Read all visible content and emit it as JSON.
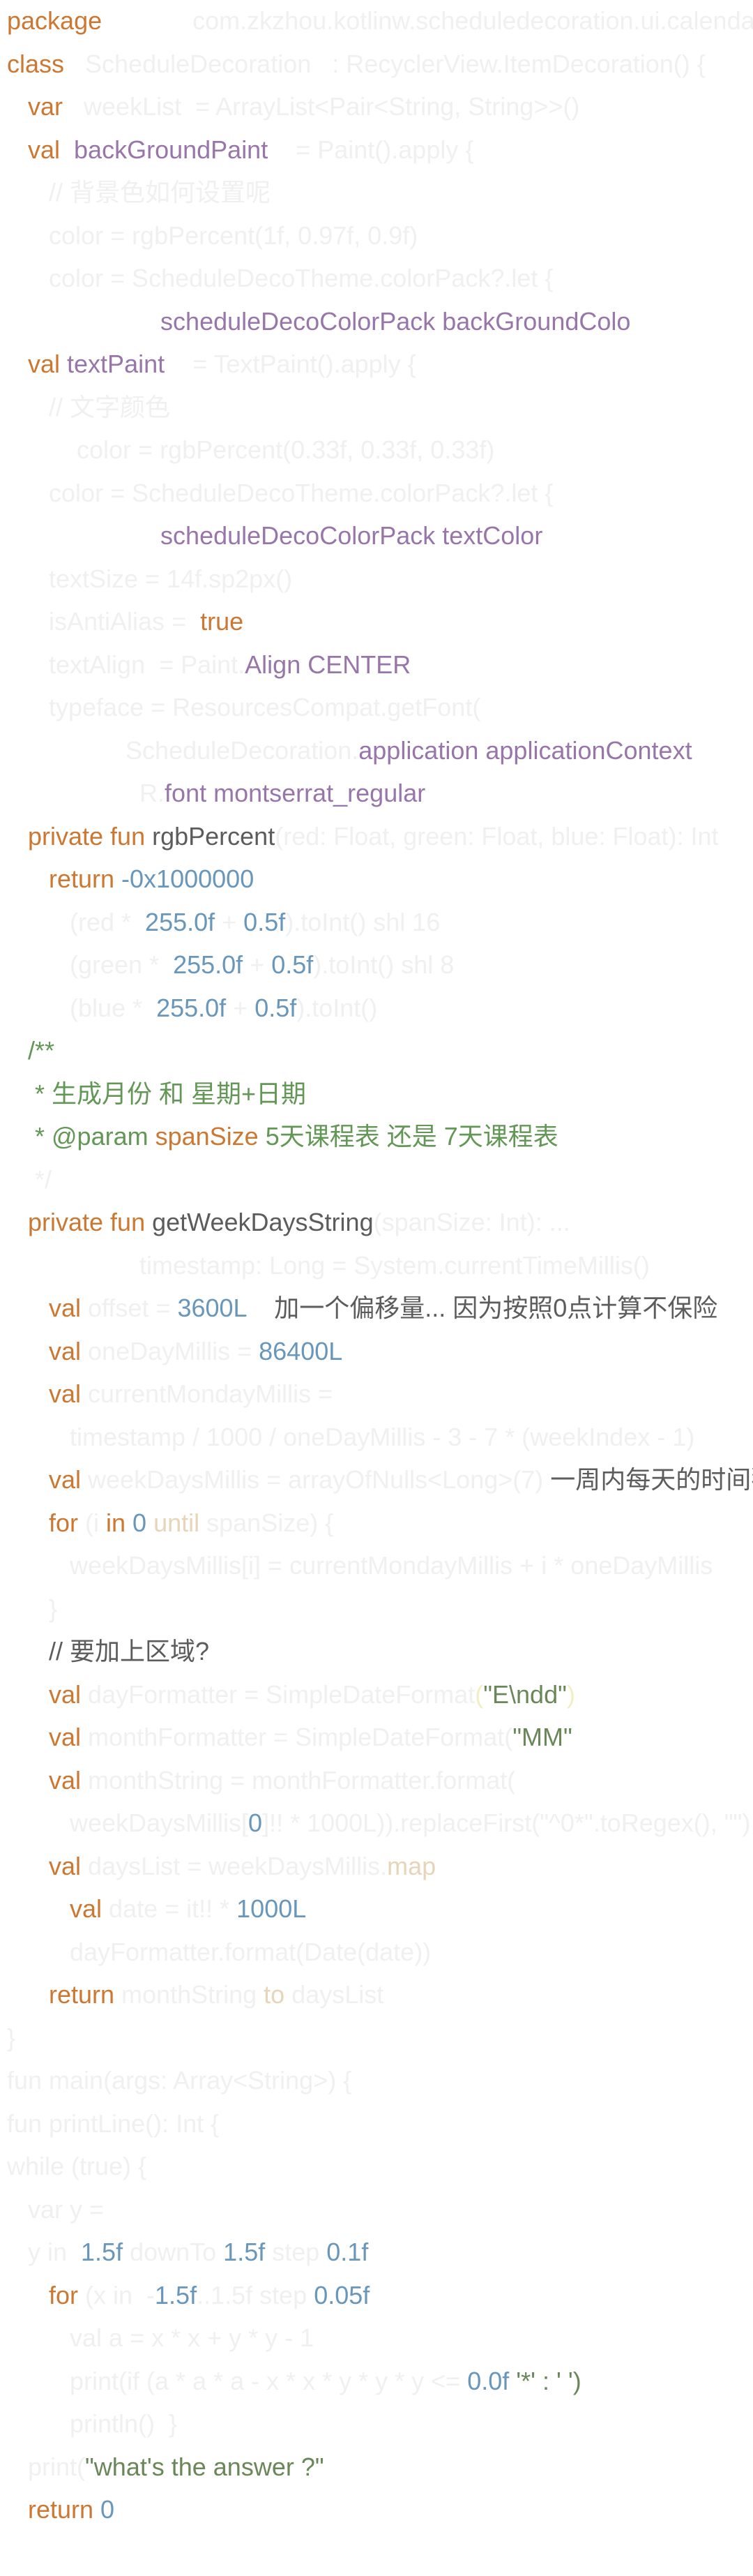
{
  "colors": {
    "keyword": "#cc7832",
    "number": "#6897bb",
    "purple": "#9876aa",
    "comment": "#629755",
    "string": "#6a8759",
    "text": "#5c5c5c",
    "faint": "#f0f0f0",
    "faint_gold": "#e6d5b8",
    "faint_yellow": "#f2eec4"
  },
  "lines": [
    {
      "indent": 0,
      "tokens": [
        {
          "t": "package",
          "c": "keyword"
        },
        {
          "t": "             com.zkzhou.kotlinw.scheduledecoration.ui.calendar",
          "c": "faint"
        }
      ]
    },
    {
      "indent": 0,
      "tokens": [
        {
          "t": "class",
          "c": "keyword"
        },
        {
          "t": "   ScheduleDecoration   : RecyclerView.ItemDecoration() {",
          "c": "faint"
        }
      ]
    },
    {
      "indent": 1,
      "tokens": [
        {
          "t": "var",
          "c": "keyword"
        },
        {
          "t": "   weekList  = ArrayList<Pair<String, String>>()",
          "c": "faint"
        }
      ]
    },
    {
      "indent": 1,
      "tokens": [
        {
          "t": "val",
          "c": "keyword"
        },
        {
          "t": "  backGroundPaint",
          "c": "purple"
        },
        {
          "t": "    = Paint().apply {",
          "c": "faint"
        }
      ]
    },
    {
      "indent": 2,
      "tokens": [
        {
          "t": "// 背景色如何设置呢",
          "c": "faint"
        }
      ]
    },
    {
      "indent": 2,
      "tokens": [
        {
          "t": "color = rgbPercent(1f, 0.97f, 0.9f)",
          "c": "faint"
        }
      ]
    },
    {
      "indent": 2,
      "tokens": [
        {
          "t": "color = ScheduleDecoTheme.colorPack?.let {",
          "c": "faint"
        }
      ]
    },
    {
      "indent": 0,
      "tokens": [
        {
          "t": "                      ",
          "c": "faint"
        },
        {
          "t": "scheduleDecoColorPack backGroundColo",
          "c": "purple"
        }
      ]
    },
    {
      "indent": 1,
      "tokens": [
        {
          "t": "val",
          "c": "keyword"
        },
        {
          "t": " textPaint",
          "c": "purple"
        },
        {
          "t": "    = TextPaint().apply {",
          "c": "faint"
        }
      ]
    },
    {
      "indent": 2,
      "tokens": [
        {
          "t": "// 文字颜色",
          "c": "faint"
        }
      ]
    },
    {
      "indent": 2,
      "tokens": [
        {
          "t": "    color = rgbPercent(0.33f, 0.33f, 0.33f)",
          "c": "faint"
        }
      ]
    },
    {
      "indent": 2,
      "tokens": [
        {
          "t": "color = ScheduleDecoTheme.colorPack?.let {",
          "c": "faint"
        }
      ]
    },
    {
      "indent": 0,
      "tokens": [
        {
          "t": "                      ",
          "c": "faint"
        },
        {
          "t": "scheduleDecoColorPack textColor",
          "c": "purple"
        }
      ]
    },
    {
      "indent": 2,
      "tokens": [
        {
          "t": "textSize = 14f.sp2px()",
          "c": "faint"
        }
      ]
    },
    {
      "indent": 2,
      "tokens": [
        {
          "t": "isAntiAlias =  ",
          "c": "faint"
        },
        {
          "t": "true",
          "c": "keyword"
        }
      ]
    },
    {
      "indent": 2,
      "tokens": [
        {
          "t": "textAlign  = Paint.",
          "c": "faint"
        },
        {
          "t": "Align CENTER",
          "c": "purple"
        }
      ]
    },
    {
      "indent": 2,
      "tokens": [
        {
          "t": "typeface = ResourcesCompat.getFont(",
          "c": "faint"
        }
      ]
    },
    {
      "indent": 0,
      "tokens": [
        {
          "t": "                 ScheduleDecoration.",
          "c": "faint"
        },
        {
          "t": "application applicationContext",
          "c": "purple"
        }
      ]
    },
    {
      "indent": 0,
      "tokens": [
        {
          "t": "                   R.",
          "c": "faint"
        },
        {
          "t": "font montserrat_regular",
          "c": "purple"
        }
      ]
    },
    {
      "indent": 1,
      "tokens": [
        {
          "t": "private fun",
          "c": "keyword"
        },
        {
          "t": " rgbPercent",
          "c": "text"
        },
        {
          "t": "(red: Float, green: Float, blue: Float): Int",
          "c": "faint"
        }
      ]
    },
    {
      "indent": 2,
      "tokens": [
        {
          "t": "return",
          "c": "keyword"
        },
        {
          "t": " -0x1000000",
          "c": "number"
        }
      ]
    },
    {
      "indent": 3,
      "tokens": [
        {
          "t": "(red *  ",
          "c": "faint"
        },
        {
          "t": "255.0f",
          "c": "number"
        },
        {
          "t": " + ",
          "c": "faint"
        },
        {
          "t": "0.5f",
          "c": "number"
        },
        {
          "t": ").toInt() shl 16",
          "c": "faint"
        }
      ]
    },
    {
      "indent": 3,
      "tokens": [
        {
          "t": "(green *  ",
          "c": "faint"
        },
        {
          "t": "255.0f",
          "c": "number"
        },
        {
          "t": " + ",
          "c": "faint"
        },
        {
          "t": "0.5f",
          "c": "number"
        },
        {
          "t": ").toInt() shl 8",
          "c": "faint"
        }
      ]
    },
    {
      "indent": 3,
      "tokens": [
        {
          "t": "(blue *  ",
          "c": "faint"
        },
        {
          "t": "255.0f",
          "c": "number"
        },
        {
          "t": " + ",
          "c": "faint"
        },
        {
          "t": "0.5f",
          "c": "number"
        },
        {
          "t": ").toInt()",
          "c": "faint"
        }
      ]
    },
    {
      "indent": 1,
      "tokens": [
        {
          "t": "/**",
          "c": "comment"
        }
      ]
    },
    {
      "indent": 1,
      "tokens": [
        {
          "t": " * 生成月份 和 星期+日期",
          "c": "comment"
        }
      ]
    },
    {
      "indent": 1,
      "tokens": [
        {
          "t": " * @param",
          "c": "comment"
        },
        {
          "t": " spanSize",
          "c": "keyword"
        },
        {
          "t": " 5天课程表 还是 7天课程表",
          "c": "comment"
        }
      ]
    },
    {
      "indent": 1,
      "tokens": [
        {
          "t": " */",
          "c": "faint"
        }
      ]
    },
    {
      "indent": 1,
      "tokens": [
        {
          "t": "private fun",
          "c": "keyword"
        },
        {
          "t": " getWeekDaysString",
          "c": "text"
        },
        {
          "t": "(spanSize: Int): ...",
          "c": "faint"
        }
      ]
    },
    {
      "indent": 0,
      "tokens": [
        {
          "t": "                   timestamp: Long = System.currentTimeMillis()",
          "c": "faint"
        }
      ]
    },
    {
      "indent": 2,
      "tokens": [
        {
          "t": "val",
          "c": "keyword"
        },
        {
          "t": " offset = ",
          "c": "faint"
        },
        {
          "t": "3600L",
          "c": "number"
        },
        {
          "t": "    加一个偏移量... 因为按照0点计算不保险",
          "c": "text"
        }
      ]
    },
    {
      "indent": 2,
      "tokens": [
        {
          "t": "val",
          "c": "keyword"
        },
        {
          "t": " oneDayMillis = ",
          "c": "faint"
        },
        {
          "t": "86400L",
          "c": "number"
        }
      ]
    },
    {
      "indent": 2,
      "tokens": [
        {
          "t": "val",
          "c": "keyword"
        },
        {
          "t": " currentMondayMillis =",
          "c": "faint"
        }
      ]
    },
    {
      "indent": 3,
      "tokens": [
        {
          "t": "timestamp / 1000 / oneDayMillis - 3 - 7 * (weekIndex - 1)",
          "c": "faint"
        }
      ]
    },
    {
      "indent": 2,
      "tokens": [
        {
          "t": "val",
          "c": "keyword"
        },
        {
          "t": " weekDaysMillis = arrayOfNulls<Long>(7)",
          "c": "faint"
        },
        {
          "t": " 一周内每天的时间戳",
          "c": "text"
        }
      ]
    },
    {
      "indent": 2,
      "tokens": [
        {
          "t": "for",
          "c": "keyword"
        },
        {
          "t": " (i ",
          "c": "faint"
        },
        {
          "t": "in",
          "c": "keyword"
        },
        {
          "t": " 0",
          "c": "number"
        },
        {
          "t": " until",
          "c": "faint_gold"
        },
        {
          "t": " spanSize) {",
          "c": "faint"
        }
      ]
    },
    {
      "indent": 3,
      "tokens": [
        {
          "t": "weekDaysMillis[i] = currentMondayMillis + i * oneDayMillis",
          "c": "faint"
        }
      ]
    },
    {
      "indent": 2,
      "tokens": [
        {
          "t": "}",
          "c": "faint"
        }
      ]
    },
    {
      "indent": 2,
      "tokens": [
        {
          "t": "// 要加上区域?",
          "c": "text"
        }
      ]
    },
    {
      "indent": 2,
      "tokens": [
        {
          "t": "val",
          "c": "keyword"
        },
        {
          "t": " dayFormatter = SimpleDateFormat",
          "c": "faint"
        },
        {
          "t": "(",
          "c": "faint_yellow"
        },
        {
          "t": "\"E\\ndd\"",
          "c": "string"
        },
        {
          "t": ")",
          "c": "faint_yellow"
        }
      ]
    },
    {
      "indent": 2,
      "tokens": [
        {
          "t": "val",
          "c": "keyword"
        },
        {
          "t": " monthFormatter = SimpleDateFormat(",
          "c": "faint"
        },
        {
          "t": "\"MM\"",
          "c": "string"
        }
      ]
    },
    {
      "indent": 2,
      "tokens": [
        {
          "t": "val",
          "c": "keyword"
        },
        {
          "t": " monthString = monthFormatter.format(",
          "c": "faint"
        }
      ]
    },
    {
      "indent": 3,
      "tokens": [
        {
          "t": "weekDaysMillis[",
          "c": "faint"
        },
        {
          "t": "0",
          "c": "number"
        },
        {
          "t": "]!! * 1000L)).replaceFirst(\"^0*\".toRegex(), \"\")",
          "c": "faint"
        }
      ]
    },
    {
      "indent": 2,
      "tokens": [
        {
          "t": "val",
          "c": "keyword"
        },
        {
          "t": " daysList = weekDaysMillis.",
          "c": "faint"
        },
        {
          "t": "map",
          "c": "faint_gold"
        }
      ]
    },
    {
      "indent": 3,
      "tokens": [
        {
          "t": "val",
          "c": "keyword"
        },
        {
          "t": " date = it!! * ",
          "c": "faint"
        },
        {
          "t": "1000L",
          "c": "number"
        }
      ]
    },
    {
      "indent": 3,
      "tokens": [
        {
          "t": "dayFormatter.format(Date(date))",
          "c": "faint"
        }
      ]
    },
    {
      "indent": 2,
      "tokens": [
        {
          "t": "return",
          "c": "keyword"
        },
        {
          "t": " monthString ",
          "c": "faint"
        },
        {
          "t": "to",
          "c": "faint_gold"
        },
        {
          "t": " daysList",
          "c": "faint"
        }
      ]
    },
    {
      "indent": 0,
      "tokens": [
        {
          "t": "}",
          "c": "faint"
        }
      ]
    },
    {
      "indent": 0,
      "tokens": [
        {
          "t": "fun main(args: Array<String>) {",
          "c": "faint"
        }
      ]
    },
    {
      "indent": 0,
      "tokens": [
        {
          "t": "fun printLine(): Int {",
          "c": "faint"
        }
      ]
    },
    {
      "indent": 0,
      "tokens": [
        {
          "t": "while (true) {",
          "c": "faint"
        }
      ]
    },
    {
      "indent": 1,
      "tokens": [
        {
          "t": "var y = ",
          "c": "faint"
        }
      ]
    },
    {
      "indent": 1,
      "tokens": [
        {
          "t": "y in  ",
          "c": "faint"
        },
        {
          "t": "1.5f",
          "c": "number"
        },
        {
          "t": " downTo ",
          "c": "faint"
        },
        {
          "t": "1.5f",
          "c": "number"
        },
        {
          "t": " step ",
          "c": "faint"
        },
        {
          "t": "0.1f",
          "c": "number"
        }
      ]
    },
    {
      "indent": 2,
      "tokens": [
        {
          "t": "for",
          "c": "keyword"
        },
        {
          "t": " (x in  -",
          "c": "faint"
        },
        {
          "t": "1.5f",
          "c": "number"
        },
        {
          "t": "..1.5f step ",
          "c": "faint"
        },
        {
          "t": "0.05f",
          "c": "number"
        }
      ]
    },
    {
      "indent": 3,
      "tokens": [
        {
          "t": "val a = x * x + y * y - 1",
          "c": "faint"
        }
      ]
    },
    {
      "indent": 3,
      "tokens": [
        {
          "t": "print(if (a * a * a - x * x * y * y * y <= ",
          "c": "faint"
        },
        {
          "t": "0.0f",
          "c": "number"
        },
        {
          "t": " '*' : ' ')",
          "c": "string"
        }
      ]
    },
    {
      "indent": 3,
      "tokens": [
        {
          "t": "println()  }",
          "c": "faint"
        }
      ]
    },
    {
      "indent": 1,
      "tokens": [
        {
          "t": "print(",
          "c": "faint"
        },
        {
          "t": "\"what's the answer ?\"",
          "c": "string"
        }
      ]
    },
    {
      "indent": 1,
      "tokens": [
        {
          "t": "return",
          "c": "keyword"
        },
        {
          "t": " 0",
          "c": "number"
        }
      ]
    }
  ]
}
